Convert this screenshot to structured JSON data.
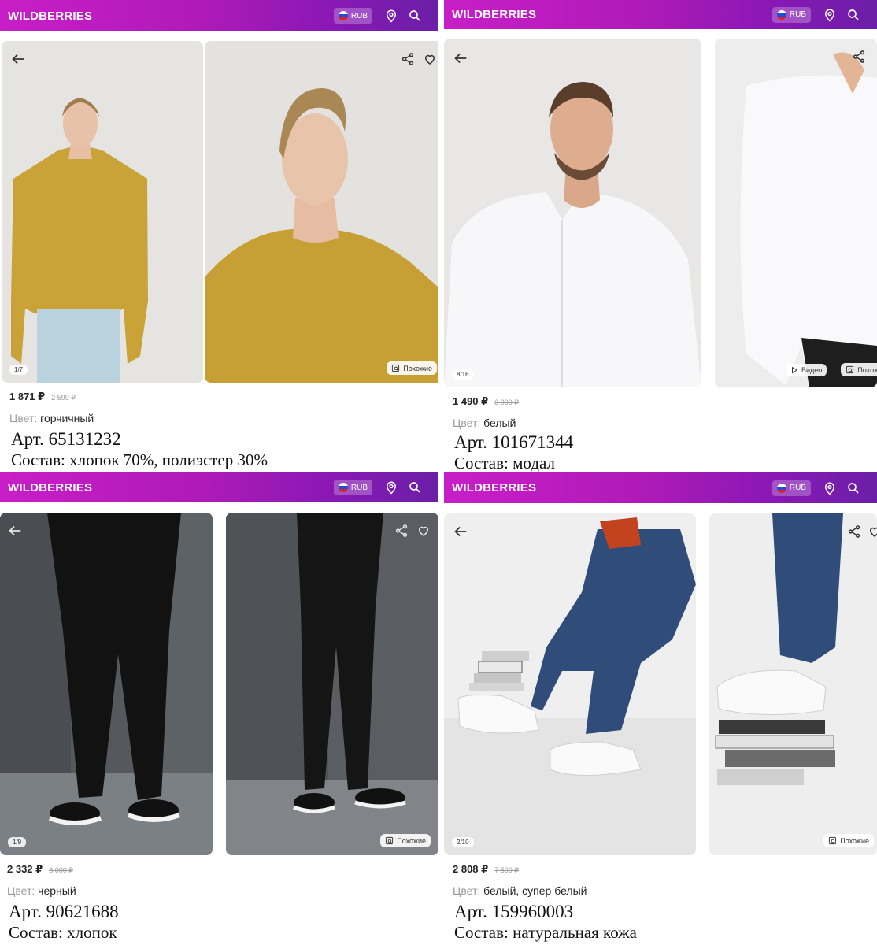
{
  "app": {
    "logo": "WILDBERRIES",
    "currency": "RUB"
  },
  "colors": {
    "header_start": "#c81ec8",
    "header_end": "#6b1fa8",
    "text": "#242424",
    "muted": "#9a9a9a"
  },
  "products": [
    {
      "counter": "1/7",
      "similar_label": "Похожие",
      "price": "1 871 ₽",
      "old_price": "2 599 ₽",
      "color_label": "Цвет:",
      "color_value": "горчичный",
      "article": "Арт. 65131232",
      "composition": "Состав: хлопок 70%, полиэстер 30%"
    },
    {
      "counter": "8/16",
      "video_label": "Видео",
      "similar_label": "Похож",
      "price": "1 490 ₽",
      "old_price": "3 000 ₽",
      "color_label": "Цвет:",
      "color_value": "белый",
      "article": "Арт. 101671344",
      "composition": "Состав: модал"
    },
    {
      "counter": "1/9",
      "similar_label": "Похожие",
      "price": "2 332 ₽",
      "old_price": "6 000 ₽",
      "color_label": "Цвет:",
      "color_value": "черный",
      "article": "Арт. 90621688",
      "composition": "Состав: хлопок"
    },
    {
      "counter": "2/10",
      "similar_label": "Похожие",
      "price": "2 808 ₽",
      "old_price": "7 500 ₽",
      "color_label": "Цвет:",
      "color_value": "белый, супер белый",
      "article": "Арт. 159960003",
      "composition": "Состав: натуральная кожа"
    }
  ],
  "icons": [
    "back-arrow-icon",
    "share-icon",
    "heart-icon",
    "location-icon",
    "search-icon",
    "similar-icon",
    "play-icon",
    "russia-flag-icon"
  ]
}
